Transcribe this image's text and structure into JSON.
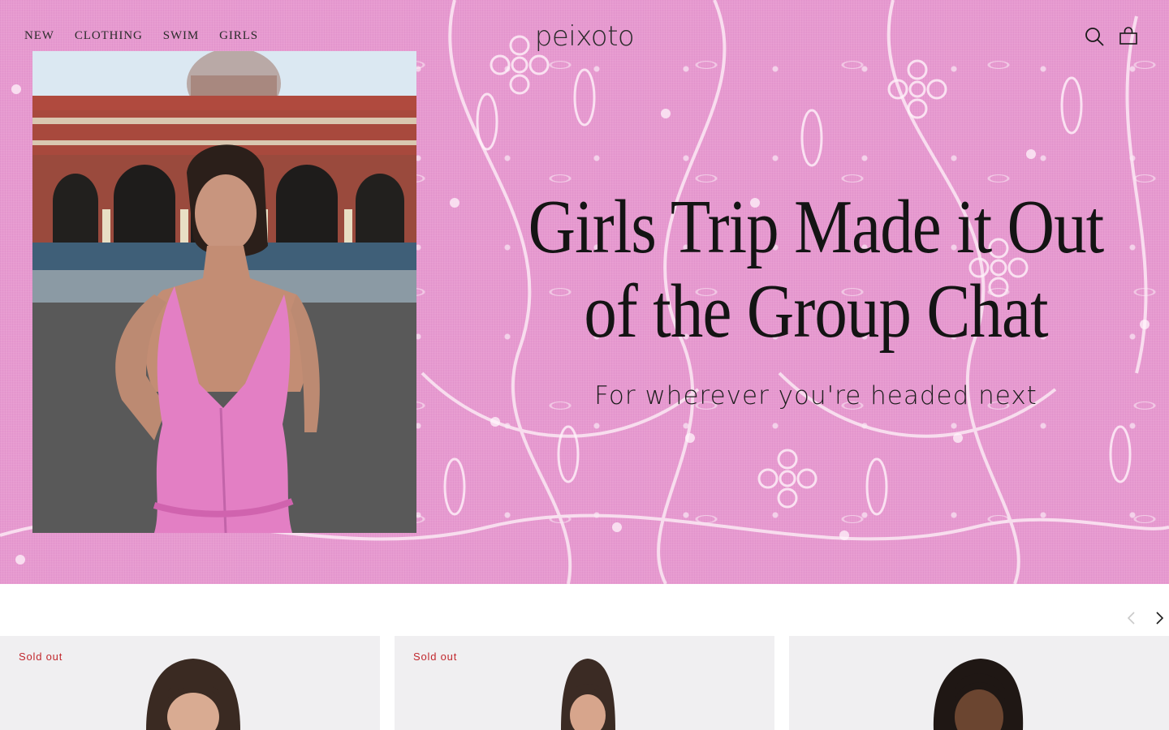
{
  "brand": {
    "logo_text": "peixoto"
  },
  "nav": {
    "items": [
      {
        "label": "NEW"
      },
      {
        "label": "CLOTHING"
      },
      {
        "label": "SWIM"
      },
      {
        "label": "GIRLS"
      }
    ]
  },
  "header_icons": {
    "search": "search-icon",
    "cart": "shopping-bag-icon"
  },
  "hero": {
    "title": "Girls Trip Made it Out of the Group Chat",
    "subtitle": "For wherever you're headed next",
    "background_color": "#e79ad0"
  },
  "carousel": {
    "prev_icon": "chevron-left-icon",
    "next_icon": "chevron-right-icon",
    "products": [
      {
        "badge": "Sold out"
      },
      {
        "badge": "Sold out"
      },
      {
        "badge": ""
      }
    ]
  },
  "colors": {
    "sold_out": "#c1272d",
    "text": "#141414"
  }
}
